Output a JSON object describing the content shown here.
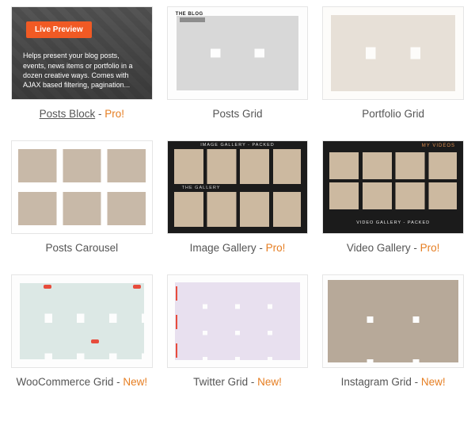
{
  "items": [
    {
      "title": "Posts Block",
      "badge": "Pro!",
      "badge_type": "pro",
      "underline": true,
      "overlay": {
        "button": "Live Preview",
        "description": "Helps present your blog posts, events, news items or portfolio in a dozen creative ways. Comes with AJAX based filtering, pagination..."
      }
    },
    {
      "title": "Posts Grid",
      "overlay_heading": "THE BLOG"
    },
    {
      "title": "Portfolio Grid"
    },
    {
      "title": "Posts Carousel"
    },
    {
      "title": "Image Gallery",
      "badge": "Pro!",
      "badge_type": "pro",
      "overlay_labels": [
        "IMAGE GALLERY - PACKED",
        "THE GALLERY"
      ]
    },
    {
      "title": "Video Gallery",
      "badge": "Pro!",
      "badge_type": "pro",
      "overlay_labels": [
        "MY VIDEOS",
        "VIDEO GALLERY - PACKED"
      ]
    },
    {
      "title": "WooCommerce Grid",
      "badge": "New!",
      "badge_type": "new"
    },
    {
      "title": "Twitter Grid",
      "badge": "New!",
      "badge_type": "new"
    },
    {
      "title": "Instagram Grid",
      "badge": "New!",
      "badge_type": "new"
    }
  ]
}
